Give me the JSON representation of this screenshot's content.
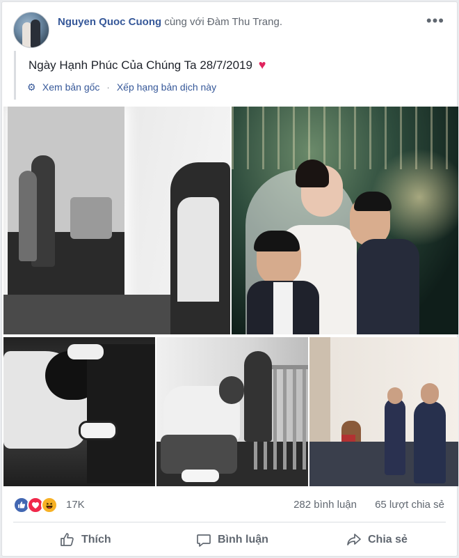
{
  "post": {
    "author": "Nguyen Quoc Cuong",
    "with_text": "cùng với",
    "tagged": "Đàm Thu Trang.",
    "more_label": "•••",
    "caption": "Ngày Hạnh Phúc Của Chúng Ta 28/7/2019",
    "translate": {
      "see_original": "Xem bản gốc",
      "separator": "·",
      "rate_translation": "Xếp hạng bản dịch này"
    },
    "photos": [
      {
        "description": "mirror-dressing-room-bw"
      },
      {
        "description": "wedding-kiss-stage"
      },
      {
        "description": "shoe-tying-bw"
      },
      {
        "description": "groom-kneeling-bw"
      },
      {
        "description": "groom-and-boy-portrait"
      }
    ]
  },
  "stats": {
    "reactions": [
      "like",
      "love",
      "haha"
    ],
    "reaction_count": "17K",
    "comments": "282 bình luận",
    "shares": "65 lượt chia sẻ"
  },
  "actions": {
    "like": "Thích",
    "comment": "Bình luận",
    "share": "Chia sẻ"
  },
  "colors": {
    "link": "#365899",
    "like": "#4267b2",
    "love": "#f0284a",
    "haha": "#f7b125",
    "heart": "#e0245e"
  }
}
